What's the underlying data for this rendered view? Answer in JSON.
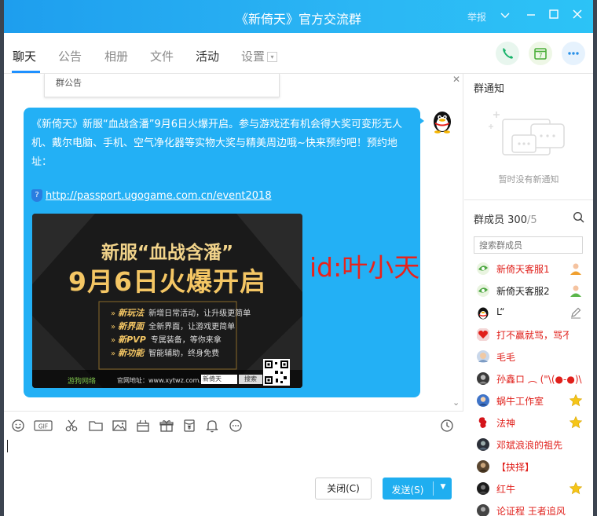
{
  "window": {
    "title": "《新倚天》官方交流群",
    "report_label": "举报"
  },
  "tabs": [
    {
      "label": "聊天",
      "active": true
    },
    {
      "label": "公告",
      "active": false
    },
    {
      "label": "相册",
      "active": false
    },
    {
      "label": "文件",
      "active": false
    },
    {
      "label": "活动",
      "active": false
    },
    {
      "label": "设置",
      "active": false
    }
  ],
  "chat": {
    "notice_card_label": "群公告",
    "message": {
      "text": "《新倚天》新服“血战含潘”9月6日火爆开启。参与游戏还有机会得大奖可变形无人机、戴尔电脑、手机、空气净化器等实物大奖与精美周边哦~快来预约吧！预约地址：",
      "link": "http://passport.ugogame.com.cn/event2018",
      "bubble_color": "#23b0f5"
    },
    "promo": {
      "line1": "新服“血战含潘”",
      "line2": "9月6日火爆开启",
      "features": [
        {
          "name": "新玩法",
          "desc": "新增日常活动，让升级更简单"
        },
        {
          "name": "新界面",
          "desc": "全新界面，让游戏更简单"
        },
        {
          "name": "新PVP",
          "desc": "专属装备，等你来拿"
        },
        {
          "name": "新功能",
          "desc": "智能辅助，终身免费"
        }
      ],
      "brand": "游狗网络",
      "site": "官网地址：www.xytwz.com.cn",
      "search_box": "新倚天",
      "search_btn": "搜索"
    },
    "watermark": "id:叶小天"
  },
  "toolbar": {
    "icons": [
      "emoji-icon",
      "gif-icon",
      "screenshot-scissors-icon",
      "folder-icon",
      "image-icon",
      "gift-box-icon",
      "gift-icon",
      "red-packet-icon",
      "bell-icon",
      "more-icon",
      "history-clock-icon"
    ],
    "gif_label": "GIF"
  },
  "compose": {
    "close_label": "关闭(C)",
    "send_label": "发送(S)",
    "accent": "#1faef0"
  },
  "sidebar": {
    "notice_title": "群通知",
    "notice_empty": "暂时没有新通知",
    "members_title": "群成员",
    "members_count": "300",
    "members_total": "/5",
    "search_placeholder": "搜索群成员",
    "members": [
      {
        "name": "新倚天客服1",
        "color": "#e0201b",
        "badge": "admin-person-icon"
      },
      {
        "name": "新倚天客服2",
        "color": "#222222",
        "badge": "admin-person-icon"
      },
      {
        "name": "L“",
        "color": "#222222",
        "badge": "edit-pen-icon"
      },
      {
        "name": "打不赢就骂，骂不赢",
        "color": "#e0201b",
        "badge": ""
      },
      {
        "name": "毛毛",
        "color": "#e0201b",
        "badge": ""
      },
      {
        "name": "孙鑫ロ ︵ (\"\\(●-●)\\",
        "color": "#e0201b",
        "badge": ""
      },
      {
        "name": "蜗牛工作室",
        "color": "#e0201b",
        "badge": "star-icon"
      },
      {
        "name": "法神",
        "color": "#e0201b",
        "badge": "star-icon"
      },
      {
        "name": "邓斌浪浪的祖先",
        "color": "#e0201b",
        "badge": ""
      },
      {
        "name": "【抉择】",
        "color": "#e0201b",
        "badge": ""
      },
      {
        "name": "红牛",
        "color": "#e0201b",
        "badge": "star-icon"
      },
      {
        "name": "论证程 王者追风",
        "color": "#e0201b",
        "badge": ""
      }
    ]
  }
}
